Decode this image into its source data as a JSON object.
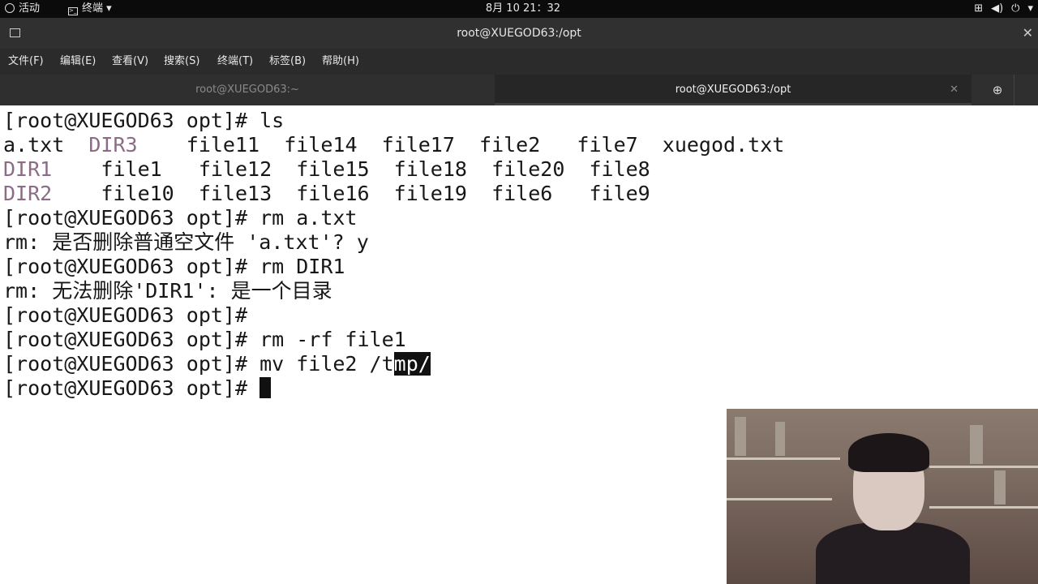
{
  "topbar": {
    "activities": "活动",
    "app_menu": "终端",
    "clock": "8月 10  21：32"
  },
  "window": {
    "title": "root@XUEGOD63:/opt"
  },
  "menu": {
    "items": [
      "文件(F)",
      "编辑(E)",
      "查看(V)",
      "搜索(S)",
      "终端(T)",
      "标签(B)",
      "帮助(H)"
    ]
  },
  "tabs": [
    {
      "label": "root@XUEGOD63:~"
    },
    {
      "label": "root@XUEGOD63:/opt"
    }
  ],
  "terminal": {
    "lines": [
      "[root@XUEGOD63 opt]# ls",
      [
        "a.txt  ",
        "DIR3",
        "    file11  file14  file17  file2   file7  xuegod.txt"
      ],
      [
        "",
        "DIR1",
        "    file1   file12  file15  file18  file20  file8"
      ],
      [
        "",
        "DIR2",
        "    file10  file13  file16  file19  file6   file9"
      ],
      "[root@XUEGOD63 opt]# rm a.txt",
      "rm: 是否删除普通空文件 'a.txt'? y",
      "[root@XUEGOD63 opt]# rm DIR1",
      "rm: 无法删除'DIR1': 是一个目录",
      "[root@XUEGOD63 opt]#",
      "[root@XUEGOD63 opt]# rm -rf file1",
      [
        "[root@XUEGOD63 opt]# mv file2 /t",
        "mp/",
        ""
      ],
      "[root@XUEGOD63 opt]# "
    ]
  },
  "colors": {
    "directory": "#8c6b86",
    "terminal_bg": "#ffffff",
    "terminal_fg": "#171717",
    "titlebar_bg": "#303030"
  }
}
